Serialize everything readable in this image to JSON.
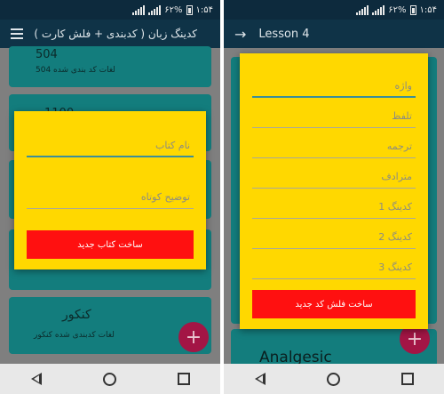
{
  "left": {
    "status": {
      "battery": "۶۲%",
      "time": "۱:۵۴"
    },
    "appbar": {
      "title": "کدینگ زبان ( کدبندی + فلش کارت )",
      "menu_icon": "hamburger-icon"
    },
    "cards": [
      {
        "title": "504",
        "subtitle": "لغات کد بندی شده 504"
      },
      {
        "title": "1100",
        "subtitle": ""
      },
      {
        "title": "",
        "subtitle": ""
      },
      {
        "title": "",
        "subtitle": ""
      },
      {
        "title": "کنکور",
        "subtitle": "لغات کدبندی شده کنکور"
      }
    ],
    "dialog": {
      "book_name_placeholder": "نام کتاب",
      "short_desc_placeholder": "توضیح کوتاه",
      "create_button": "ساخت کتاب جدید"
    },
    "fab": "+"
  },
  "right": {
    "status": {
      "battery": "۶۲%",
      "time": "۱:۵۴"
    },
    "appbar": {
      "title": "Lesson 4",
      "back_icon": "arrow-right-icon"
    },
    "cards": [
      {
        "title": "Analgesic"
      }
    ],
    "dialog": {
      "fields": [
        "واژه",
        "تلفظ",
        "ترجمه",
        "مترادف",
        "کدینگ 1",
        "کدینگ 2",
        "کدینگ 3"
      ],
      "create_button": "ساخت فلش کد جدید"
    },
    "fab": "+"
  },
  "colors": {
    "dialog": "#ffd800",
    "button": "#ff1010",
    "card": "#137d7d",
    "fab": "#a31545",
    "appbar": "#0f3347"
  }
}
